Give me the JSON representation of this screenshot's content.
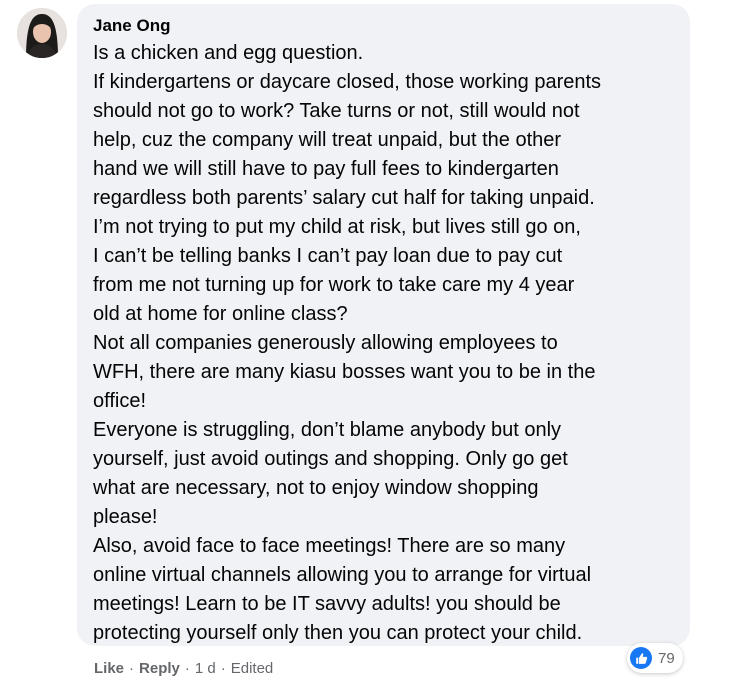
{
  "comment": {
    "author": "Jane Ong",
    "lines": [
      "Is a chicken and egg question.",
      "If kindergartens or daycare closed, those working parents",
      "should not go to work? Take turns or not, still would not",
      "help, cuz the company will treat unpaid, but the other",
      "hand we will still have to pay full fees to kindergarten",
      "regardless both parents’ salary cut half for taking unpaid.",
      "I’m not trying to put my child at risk, but lives still go on,",
      "I can’t be telling banks I can’t pay loan due to pay cut",
      "from me not turning up for work to take care my 4 year",
      "old at home for online class?",
      "Not all companies generously allowing employees to",
      "WFH, there are many kiasu bosses want you to be in the",
      "office!",
      "Everyone is struggling, don’t blame anybody but only",
      "yourself, just avoid outings and shopping. Only go get",
      "what are necessary, not to enjoy window shopping",
      "please!",
      "Also, avoid face to face meetings! There are so many",
      "online virtual channels allowing you to arrange for virtual",
      "meetings! Learn to be IT savvy adults! you should be",
      "protecting yourself only then you can protect your child."
    ]
  },
  "actions": {
    "like_label": "Like",
    "separator": "·",
    "reply_label": "Reply",
    "time": "1 d",
    "edited": "Edited"
  },
  "reactions": {
    "icon": "thumbs-up-icon",
    "count": "79",
    "color": "#1877f2"
  },
  "colors": {
    "bubble": "#f0f2f5",
    "text": "#050505",
    "meta": "#65676b"
  }
}
